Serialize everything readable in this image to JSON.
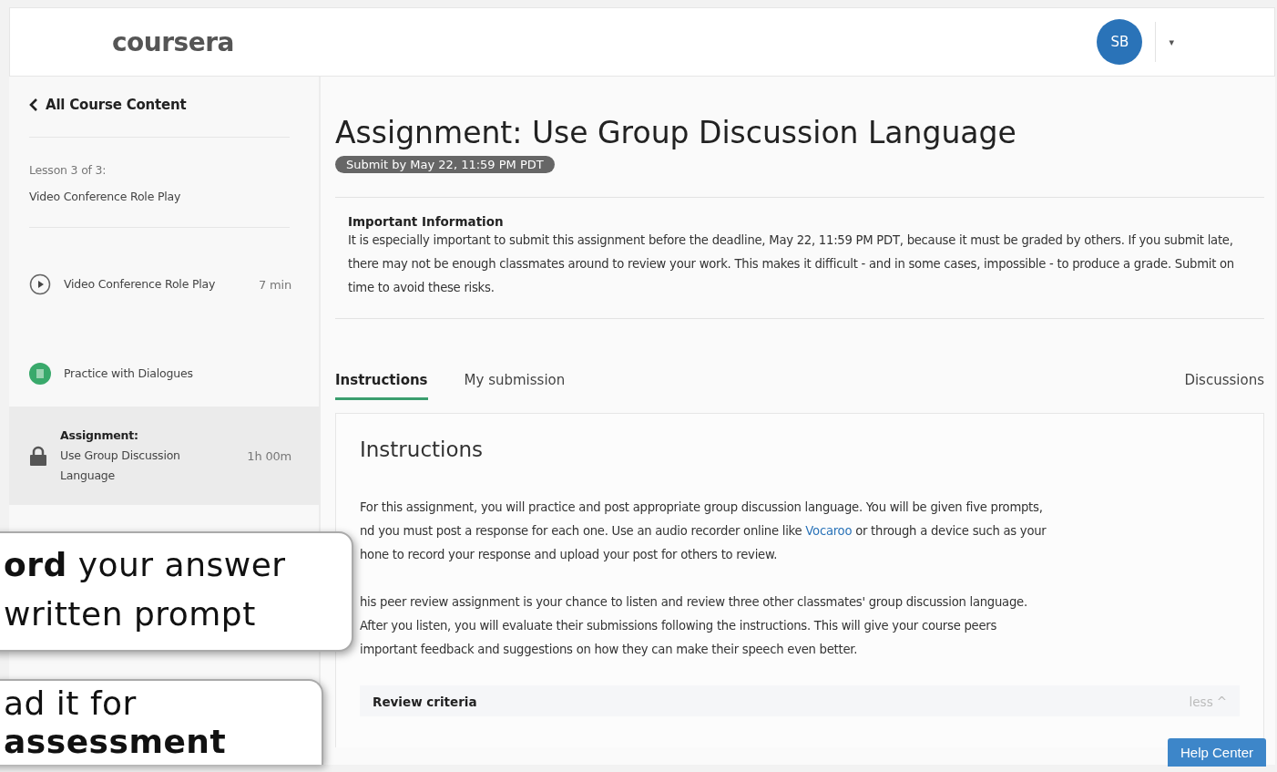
{
  "header": {
    "logo": "coursera",
    "avatar": "SB",
    "menu_caret": "▾"
  },
  "sidebar": {
    "back": "All Course Content",
    "lesson_label": "Lesson 3 of 3:",
    "lesson_title": "Video Conference Role Play",
    "items": [
      {
        "kind": "video",
        "title": "Video Conference Role Play",
        "duration": "7 min",
        "selected": false
      },
      {
        "kind": "reading",
        "title": "Practice with Dialogues",
        "selected": false
      },
      {
        "kind": "assignment",
        "label": "Assignment:",
        "title": "Use Group Discussion Language",
        "duration": "1h 00m",
        "selected": true
      }
    ]
  },
  "main": {
    "title": "Assignment: Use Group Discussion Language",
    "deadline_badge": "Submit by May 22, 11:59 PM PDT",
    "notice": {
      "heading": "Important Information",
      "text": "It is especially important to submit this assignment before the deadline, May 22, 11:59 PM PDT, because it must be graded by others. If you submit late, there may not be enough classmates around to review your work. This makes it difficult - and in some cases, impossible - to produce a grade. Submit on time to avoid these risks."
    },
    "tabs": [
      {
        "label": "Instructions",
        "selected": true
      },
      {
        "label": "My submission",
        "selected": false
      },
      {
        "label": "Discussions",
        "selected": false
      }
    ],
    "instructions": {
      "heading": "Instructions",
      "paragraphs": [
        [
          "For this assignment, you will practice and post appropriate group discussion language. You will be given five prompts,",
          [
            {
              "text": "nd you must post a response for each one. Use an audio recorder online like "
            },
            {
              "kind": "link",
              "text": "Vocaroo"
            },
            {
              "text": " or through a device such as your"
            }
          ],
          "hone to record your response and upload your post for others to review."
        ],
        [
          "his peer review assignment is your chance to listen and review three other classmates' group discussion language.",
          "After you listen, you will evaluate their submissions following the instructions. This will give your course peers",
          "important feedback and suggestions on how they can make their speech even better."
        ]
      ],
      "review_criteria": "Review criteria",
      "toggle": "less",
      "toggle_caret": "^"
    },
    "help_button": "Help Center"
  },
  "callouts": [
    {
      "lines": [
        "**ord** your answer",
        "written prompt"
      ]
    },
    {
      "lines": [
        "ad it for",
        "**assessment**"
      ]
    }
  ]
}
